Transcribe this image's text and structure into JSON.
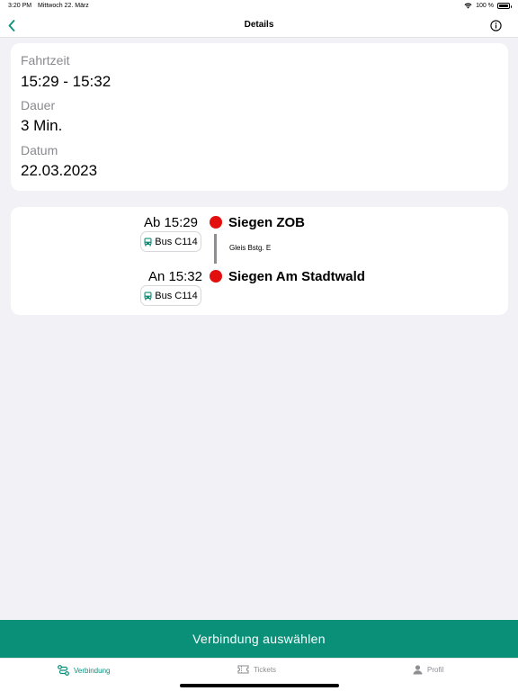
{
  "status_bar": {
    "time": "3:20 PM",
    "date": "Mittwoch 22. März",
    "battery": "100 %"
  },
  "nav": {
    "title": "Details",
    "back_icon": "chevron-left-icon",
    "info_icon": "info-icon"
  },
  "info_card": {
    "fahrtzeit_label": "Fahrtzeit",
    "fahrtzeit_value": "15:29 - 15:32",
    "dauer_label": "Dauer",
    "dauer_value": "3 Min.",
    "datum_label": "Datum",
    "datum_value": "22.03.2023"
  },
  "journey": {
    "departure": {
      "time": "Ab 15:29",
      "mode": "Bus C114",
      "stop": "Siegen ZOB",
      "platform": "Gleis Bstg. E"
    },
    "arrival": {
      "time": "An 15:32",
      "mode": "Bus C114",
      "stop": "Siegen Am Stadtwald"
    }
  },
  "cta": {
    "label": "Verbindung auswählen"
  },
  "tabs": [
    {
      "label": "Verbindung",
      "icon": "route-icon",
      "active": true
    },
    {
      "label": "Tickets",
      "icon": "ticket-icon",
      "active": false
    },
    {
      "label": "Profil",
      "icon": "person-icon",
      "active": false
    }
  ],
  "colors": {
    "accent": "#0a8f78",
    "stop_dot": "#e30f0f",
    "background": "#f2f1f6"
  }
}
